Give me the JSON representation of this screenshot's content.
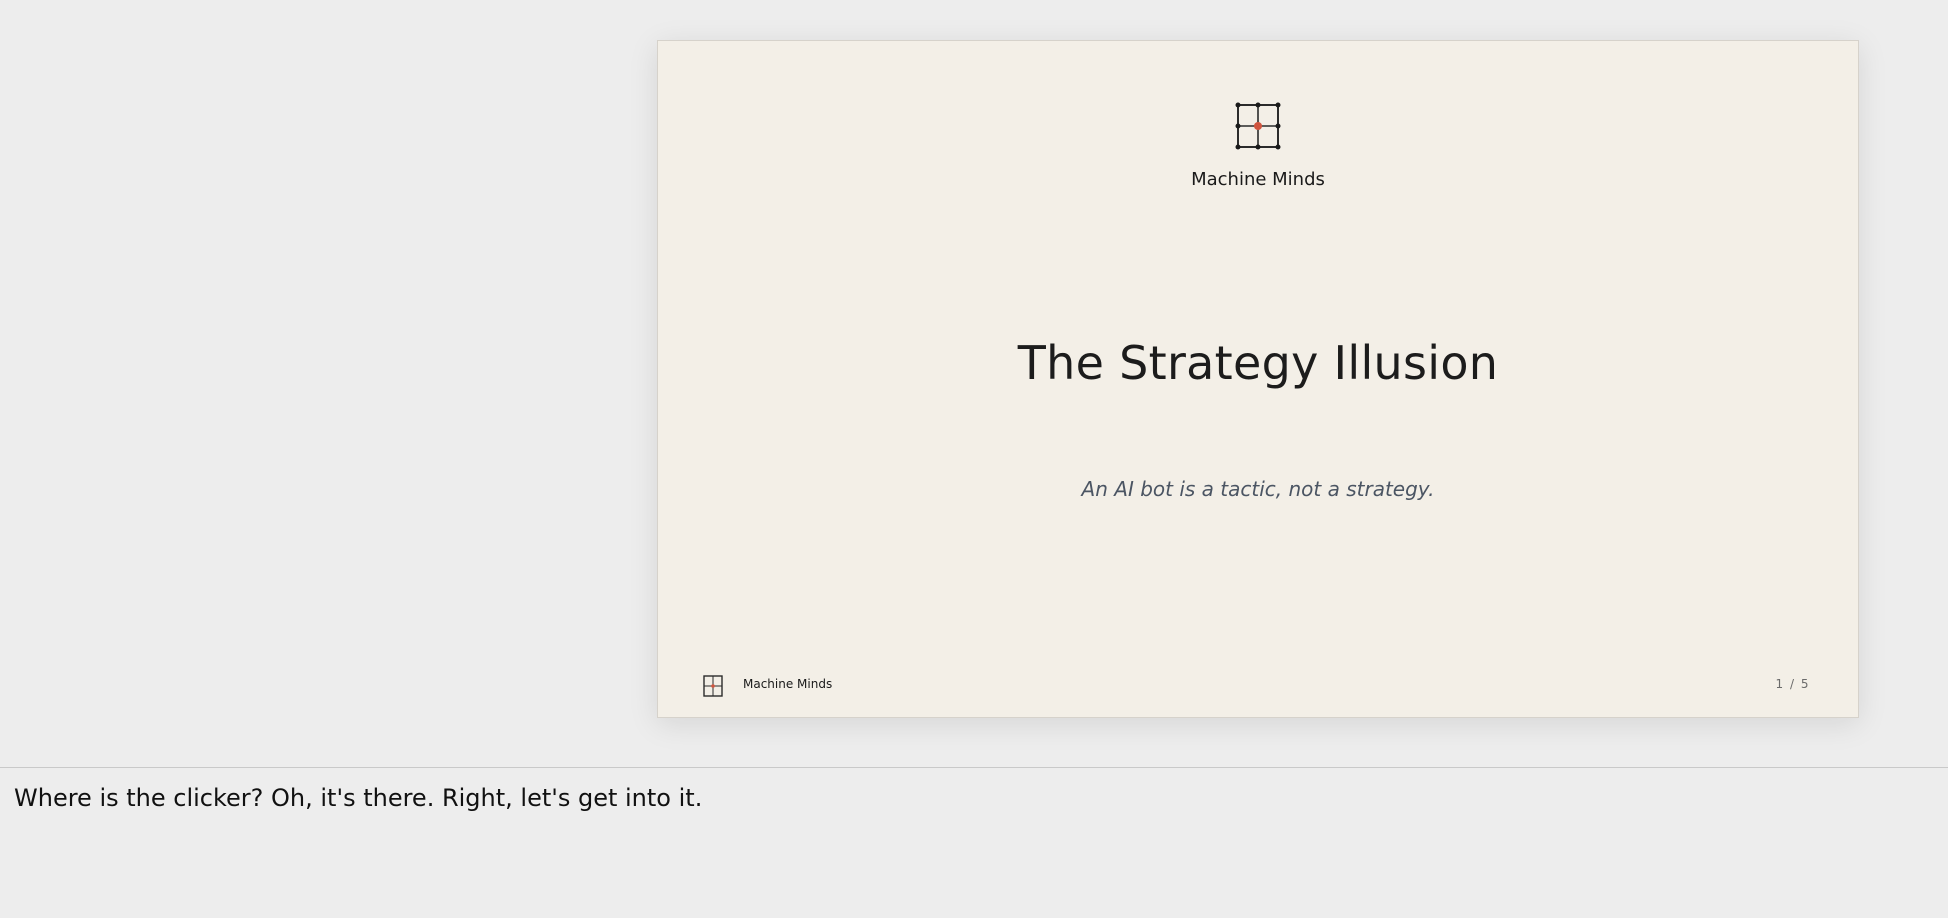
{
  "slide": {
    "brand_name": "Machine Minds",
    "title": "The Strategy Illusion",
    "subtitle": "An AI bot is a tactic, not a strategy.",
    "footer_brand": "Machine Minds",
    "page_indicator": "1 / 5",
    "logo_icon": "grid-logo-icon",
    "accent_color": "#d0553f",
    "background_color": "#f3efe7"
  },
  "notes": {
    "text": "Where is the clicker? Oh, it's there. Right, let's get into it."
  }
}
